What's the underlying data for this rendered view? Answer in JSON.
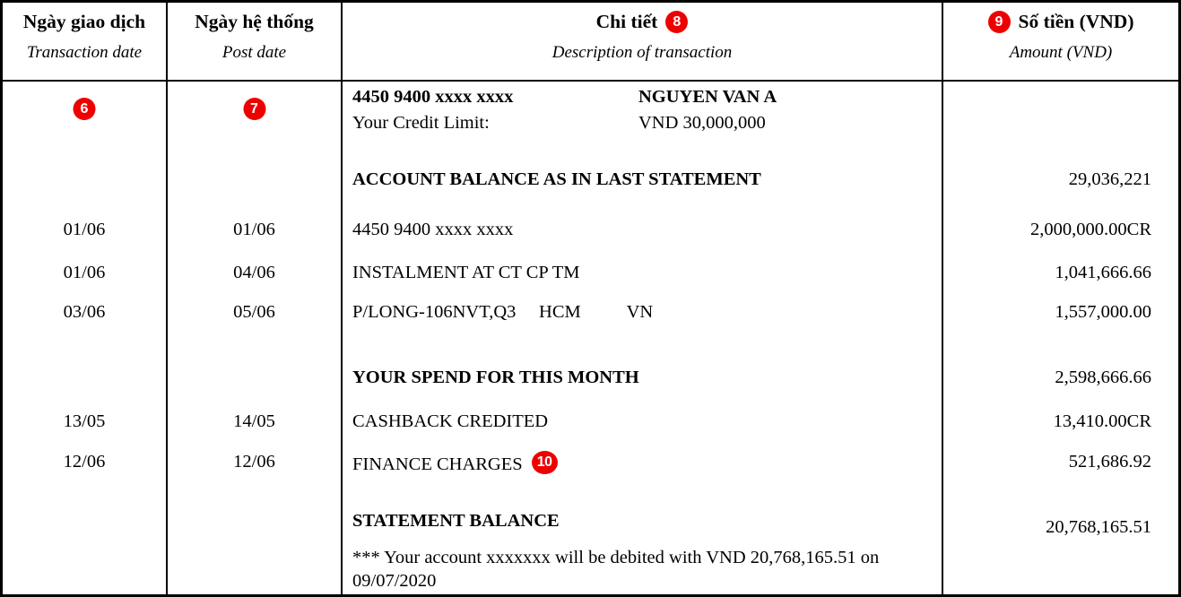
{
  "table": {
    "columns": [
      {
        "title_vi": "Ngày giao dịch",
        "title_en": "Transaction date",
        "badge": null
      },
      {
        "title_vi": "Ngày hệ thống",
        "title_en": "Post date",
        "badge": null
      },
      {
        "title_vi": "Chi tiết",
        "title_en": "Description of transaction",
        "badge": "8"
      },
      {
        "title_vi": "Số tiền (VND)",
        "title_en": "Amount (VND)",
        "badge": "9"
      }
    ],
    "column_badges": {
      "transaction_date": "6",
      "post_date": "7",
      "finance_charges": "10"
    }
  },
  "account": {
    "card_number": "4450 9400 xxxx xxxx",
    "card_holder": "NGUYEN VAN A",
    "credit_limit_label": "Your Credit Limit:",
    "credit_limit_value": "VND 30,000,000"
  },
  "transactions": [
    {
      "transaction_date": "",
      "post_date": "",
      "description": "ACCOUNT BALANCE AS IN LAST STATEMENT",
      "amount": "29,036,221",
      "bold": true
    },
    {
      "transaction_date": "01/06",
      "post_date": "01/06",
      "description": "4450 9400 xxxx xxxx",
      "amount": "2,000,000.00CR",
      "bold": false
    },
    {
      "transaction_date": "01/06",
      "post_date": "04/06",
      "description": "INSTALMENT AT CT CP TM",
      "amount": "1,041,666.66",
      "bold": false
    },
    {
      "transaction_date": "03/06",
      "post_date": "05/06",
      "description": "P/LONG-106NVT,Q3     HCM          VN",
      "amount": "1,557,000.00",
      "bold": false
    },
    {
      "transaction_date": "",
      "post_date": "",
      "description": "YOUR SPEND FOR THIS MONTH",
      "amount": "2,598,666.66",
      "bold": true
    },
    {
      "transaction_date": "13/05",
      "post_date": "14/05",
      "description": "CASHBACK CREDITED",
      "amount": "13,410.00CR",
      "bold": false
    },
    {
      "transaction_date": "12/06",
      "post_date": "12/06",
      "description": "FINANCE CHARGES",
      "amount": "521,686.92",
      "bold": false
    },
    {
      "transaction_date": "",
      "post_date": "",
      "description": "STATEMENT BALANCE",
      "amount": "20,768,165.51",
      "bold": true
    }
  ],
  "footnote": "*** Your account xxxxxxx will be debited with VND 20,768,165.51 on 09/07/2020",
  "colors": {
    "badge_red": "#ee0000",
    "text": "#000000",
    "border": "#000000",
    "background": "#ffffff"
  }
}
